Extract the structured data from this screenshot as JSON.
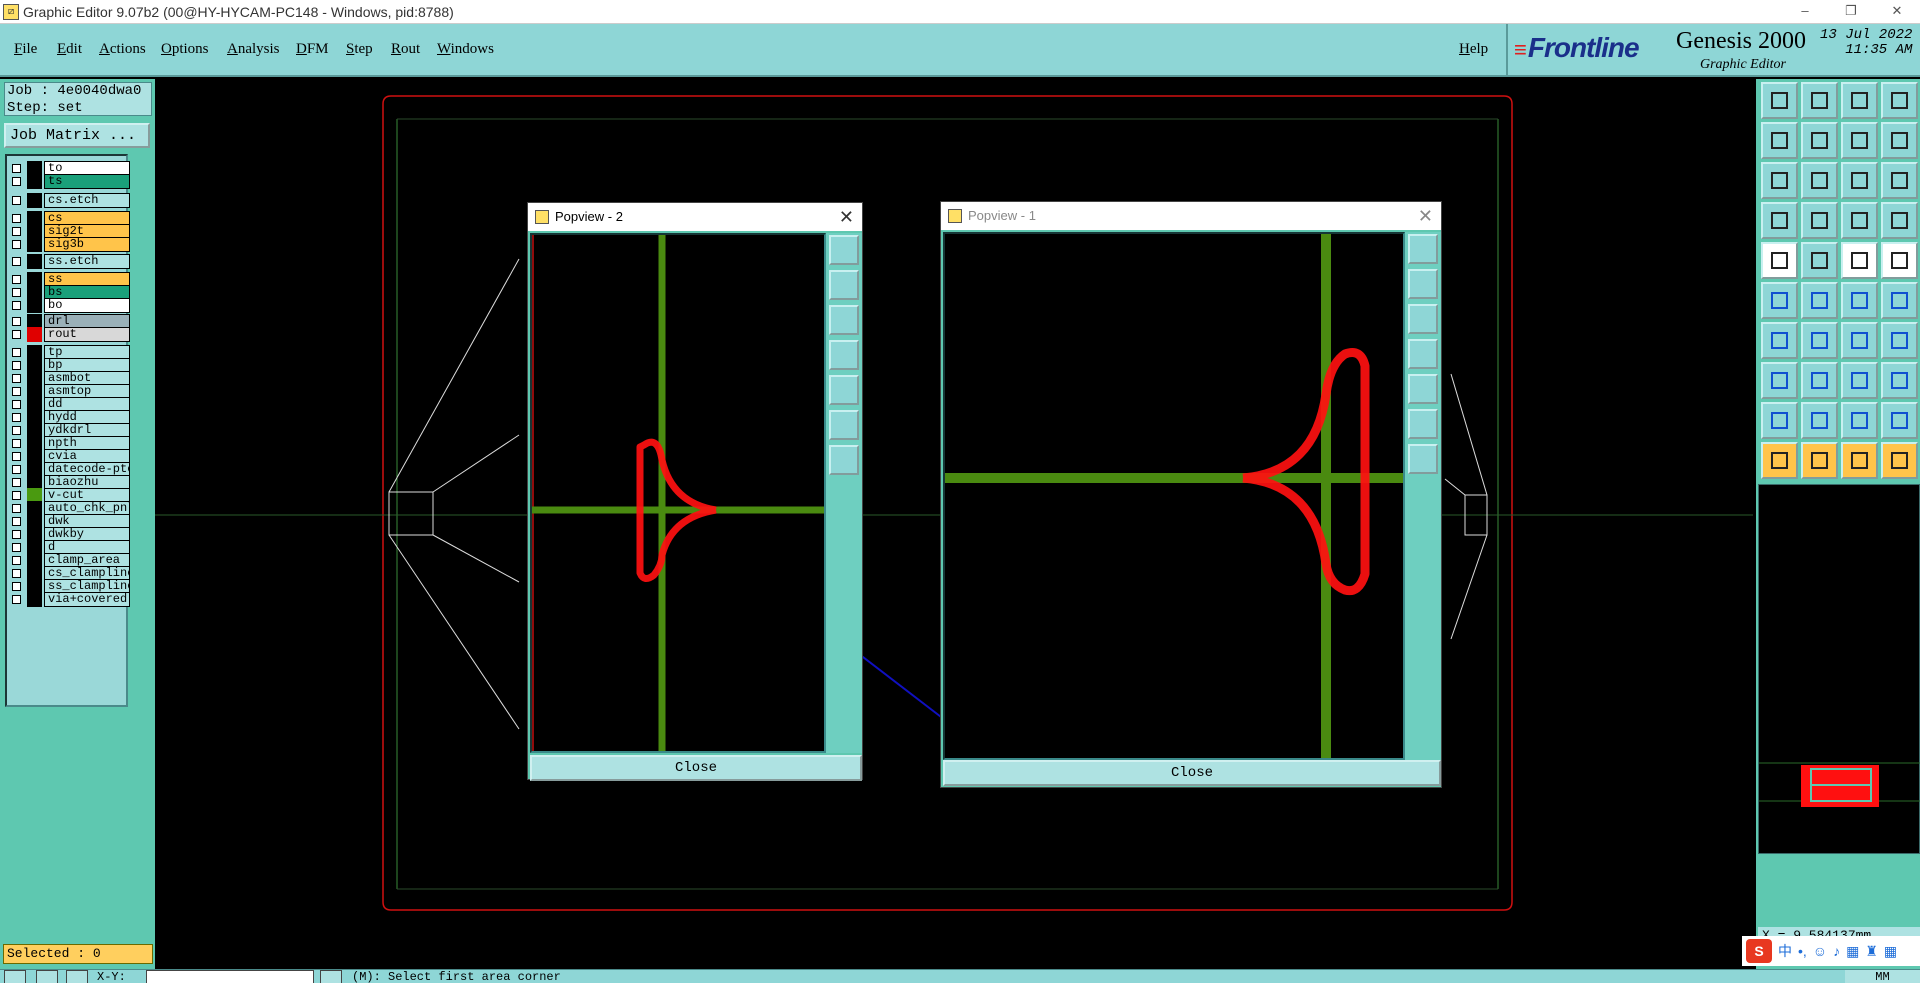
{
  "window": {
    "title": "Graphic Editor 9.07b2 (00@HY-HYCAM-PC148 - Windows, pid:8788)",
    "min": "–",
    "max": "❐",
    "close": "✕"
  },
  "menu": {
    "file": "File",
    "edit": "Edit",
    "actions": "Actions",
    "options": "Options",
    "analysis": "Analysis",
    "dfm": "DFM",
    "step": "Step",
    "rout": "Rout",
    "windows": "Windows",
    "help": "Help"
  },
  "brand": {
    "logo": "Frontline",
    "product": "Genesis 2000",
    "subtitle": "Graphic Editor",
    "date": "13 Jul 2022",
    "time": "11:35 AM"
  },
  "job": {
    "job_line": "Job : 4e0040dwa0",
    "step_line": "Step: set",
    "matrix_button": "Job Matrix ..."
  },
  "layers": [
    {
      "name": "to",
      "bg": "#ffffff",
      "swatch": "#000000"
    },
    {
      "name": "ts",
      "bg": "#1aa07a",
      "swatch": "#000000"
    },
    {
      "name": "cs.etch",
      "bg": "#aee2e2",
      "swatch": "#000000"
    },
    {
      "name": "cs",
      "bg": "#ffc44a",
      "swatch": "#000000"
    },
    {
      "name": "sig2t",
      "bg": "#ffc44a",
      "swatch": "#000000"
    },
    {
      "name": "sig3b",
      "bg": "#ffc44a",
      "swatch": "#000000"
    },
    {
      "name": "ss.etch",
      "bg": "#aee2e2",
      "swatch": "#000000"
    },
    {
      "name": "ss",
      "bg": "#ffc44a",
      "swatch": "#000000"
    },
    {
      "name": "bs",
      "bg": "#1aa07a",
      "swatch": "#000000"
    },
    {
      "name": "bo",
      "bg": "#ffffff",
      "swatch": "#000000"
    },
    {
      "name": "drl",
      "bg": "#9ab0b8",
      "swatch": "#000000"
    },
    {
      "name": "rout",
      "bg": "#d8d8d8",
      "swatch": "#e00000"
    },
    {
      "name": "tp",
      "bg": "#aee2e2",
      "swatch": "#000000"
    },
    {
      "name": "bp",
      "bg": "#aee2e2",
      "swatch": "#000000"
    },
    {
      "name": "asmbot",
      "bg": "#aee2e2",
      "swatch": "#000000"
    },
    {
      "name": "asmtop",
      "bg": "#aee2e2",
      "swatch": "#000000"
    },
    {
      "name": "dd",
      "bg": "#aee2e2",
      "swatch": "#000000"
    },
    {
      "name": "hydd",
      "bg": "#aee2e2",
      "swatch": "#000000"
    },
    {
      "name": "ydkdrl",
      "bg": "#aee2e2",
      "swatch": "#000000"
    },
    {
      "name": "npth",
      "bg": "#aee2e2",
      "swatch": "#000000"
    },
    {
      "name": "cvia",
      "bg": "#aee2e2",
      "swatch": "#000000"
    },
    {
      "name": "datecode-pte",
      "bg": "#aee2e2",
      "swatch": "#000000"
    },
    {
      "name": "biaozhu",
      "bg": "#aee2e2",
      "swatch": "#000000"
    },
    {
      "name": "v-cut",
      "bg": "#aee2e2",
      "swatch": "#4a9a10"
    },
    {
      "name": "auto_chk_pnl",
      "bg": "#aee2e2",
      "swatch": "#000000"
    },
    {
      "name": "dwk",
      "bg": "#aee2e2",
      "swatch": "#000000"
    },
    {
      "name": "dwkby",
      "bg": "#aee2e2",
      "swatch": "#000000"
    },
    {
      "name": "d",
      "bg": "#aee2e2",
      "swatch": "#000000"
    },
    {
      "name": "clamp_area",
      "bg": "#aee2e2",
      "swatch": "#000000"
    },
    {
      "name": "cs_clampline",
      "bg": "#aee2e2",
      "swatch": "#000000"
    },
    {
      "name": "ss_clampline",
      "bg": "#aee2e2",
      "swatch": "#000000"
    },
    {
      "name": "via+covered",
      "bg": "#aee2e2",
      "swatch": "#000000"
    }
  ],
  "selected": "Selected : 0",
  "popview2": {
    "title": "Popview - 2",
    "close_label": "Close",
    "x": "✕"
  },
  "popview1": {
    "title": "Popview - 1",
    "close_label": "Close",
    "x": "✕"
  },
  "coords": "X = 9.584137mm",
  "status": {
    "mode": "X-Y:",
    "prompt": "(M): Select first area corner",
    "units": "MM"
  },
  "ime": {
    "logo": "S",
    "lang": "中"
  },
  "colors": {
    "rout": "#ff1010",
    "vcut": "#4a8a10",
    "arrow": "#1010c0",
    "panel": "#5ec8b0",
    "menubar": "#8ed6d6"
  }
}
